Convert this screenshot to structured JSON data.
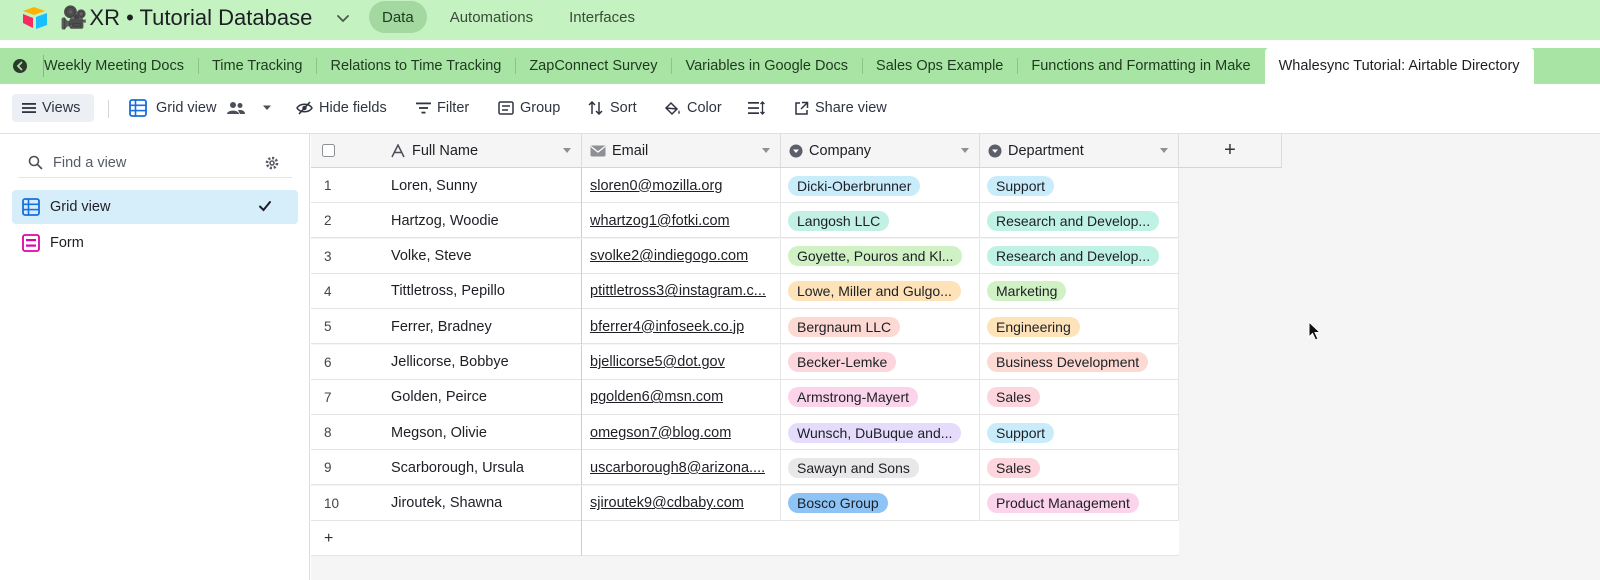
{
  "header": {
    "base_title": "XR • Tutorial Database",
    "title_emoji": "🎥",
    "nav": [
      {
        "label": "Data",
        "active": true
      },
      {
        "label": "Automations",
        "active": false
      },
      {
        "label": "Interfaces",
        "active": false
      }
    ]
  },
  "tabs": [
    {
      "label": "Weekly Meeting Docs"
    },
    {
      "label": "Time Tracking"
    },
    {
      "label": "Relations to Time Tracking"
    },
    {
      "label": "ZapConnect Survey"
    },
    {
      "label": "Variables in Google Docs"
    },
    {
      "label": "Sales Ops Example"
    },
    {
      "label": "Functions and Formatting in Make"
    },
    {
      "label": "Whalesync Tutorial: Airtable Directory",
      "active": true
    }
  ],
  "toolbar": {
    "views_label": "Views",
    "grid_view_label": "Grid view",
    "hide_fields_label": "Hide fields",
    "filter_label": "Filter",
    "group_label": "Group",
    "sort_label": "Sort",
    "color_label": "Color",
    "share_view_label": "Share view"
  },
  "sidebar": {
    "find_placeholder": "Find a view",
    "views": [
      {
        "label": "Grid view",
        "active": true
      },
      {
        "label": "Form",
        "active": false
      }
    ]
  },
  "grid": {
    "columns": [
      {
        "label": "Full Name"
      },
      {
        "label": "Email"
      },
      {
        "label": "Company"
      },
      {
        "label": "Department"
      }
    ],
    "rows": [
      {
        "n": "1",
        "name": "Loren, Sunny",
        "email": "sloren0@mozilla.org",
        "company": "Dicki-Oberbrunner",
        "company_color": "#c9ecfb",
        "dept": "Support",
        "dept_color": "#c9ecfb"
      },
      {
        "n": "2",
        "name": "Hartzog, Woodie",
        "email": "whartzog1@fotki.com",
        "company": "Langosh LLC",
        "company_color": "#c2f0e4",
        "dept": "Research and Develop...",
        "dept_color": "#bff2e4"
      },
      {
        "n": "3",
        "name": "Volke, Steve",
        "email": "svolke2@indiegogo.com",
        "company": "Goyette, Pouros and Kl...",
        "company_color": "#cff1c4",
        "dept": "Research and Develop...",
        "dept_color": "#bff2e4"
      },
      {
        "n": "4",
        "name": "Tittletross, Pepillo",
        "email": "ptittletross3@instagram.c...",
        "company": "Lowe, Miller and Gulgo...",
        "company_color": "#ffe3b8",
        "dept": "Marketing",
        "dept_color": "#cff1c4"
      },
      {
        "n": "5",
        "name": "Ferrer, Bradney",
        "email": "bferrer4@infoseek.co.jp",
        "company": "Bergnaum LLC",
        "company_color": "#fcd9d2",
        "dept": "Engineering",
        "dept_color": "#ffe3b8"
      },
      {
        "n": "6",
        "name": "Jellicorse, Bobbye",
        "email": "bjellicorse5@dot.gov",
        "company": "Becker-Lemke",
        "company_color": "#fcd6dc",
        "dept": "Business Development",
        "dept_color": "#fcd9d2"
      },
      {
        "n": "7",
        "name": "Golden, Peirce",
        "email": "pgolden6@msn.com",
        "company": "Armstrong-Mayert",
        "company_color": "#fbd4ec",
        "dept": "Sales",
        "dept_color": "#fcd6dc"
      },
      {
        "n": "8",
        "name": "Megson, Olivie",
        "email": "omegson7@blog.com",
        "company": "Wunsch, DuBuque and...",
        "company_color": "#e5dbfb",
        "dept": "Support",
        "dept_color": "#c9ecfb"
      },
      {
        "n": "9",
        "name": "Scarborough, Ursula",
        "email": "uscarborough8@arizona....",
        "company": "Sawayn and Sons",
        "company_color": "#e8e8e8",
        "dept": "Sales",
        "dept_color": "#fcd6dc"
      },
      {
        "n": "10",
        "name": "Jiroutek, Shawna",
        "email": "sjiroutek9@cdbaby.com",
        "company": "Bosco Group",
        "company_color": "#8ec3f5",
        "dept": "Product Management",
        "dept_color": "#fbd4ec"
      }
    ]
  }
}
